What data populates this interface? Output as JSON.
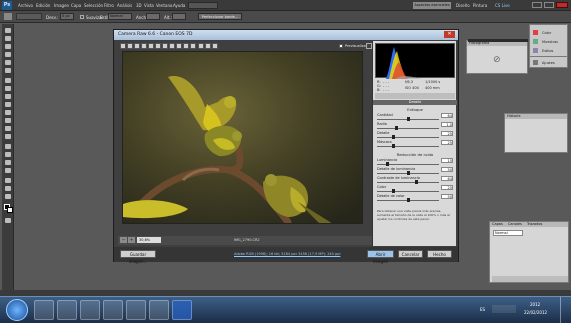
{
  "menubar": {
    "app_icon": "Ps",
    "items": [
      "Archivo",
      "Edición",
      "Imagen",
      "Capa",
      "Selección",
      "Filtro",
      "Análisis",
      "3D",
      "Vista",
      "Ventana",
      "Ayuda"
    ],
    "workspace_button": "Aspectos esenciales",
    "diseno": "Diseño",
    "pintura": "Pintura",
    "cs_live": "CS Live"
  },
  "optbar": {
    "desvanecer_label": "Desv.:",
    "desvanecer_value": "0 px",
    "suavizar_label": "Suavizar",
    "estilo_label": "Estilo:",
    "estilo_value": "Normal",
    "anch_label": "Anch.:",
    "alt_label": "Alt.:",
    "refine_button": "Perfeccionar borde..."
  },
  "dialog": {
    "title": "Camera Raw 6.6  -  Canon EOS 7D",
    "preview_label": "Previsualizar",
    "zoom_value": "30,6%",
    "filename": "IMG_2790.CR2",
    "workflow_link": "Adobe RGB (1998); 16 bit; 5184 por 3456 (17,9 MP); 240 ppi",
    "save_button": "Guardar imagen...",
    "open_button": "Abrir imagen",
    "cancel_button": "Cancelar",
    "done_button": "Hecho",
    "readout": {
      "f_value": "f/6,3",
      "shutter": "1/1000 s",
      "iso": "ISO 400",
      "lens": "400 mm",
      "r": "R:",
      "g": "G:",
      "b": "B:",
      "r_val": "- - -",
      "g_val": "- - -",
      "b_val": "- - -"
    },
    "panel_title": "Detalle",
    "sharpen_header": "Enfoque",
    "sharpen": [
      {
        "label": "Cantidad",
        "value": "64"
      },
      {
        "label": "Radio",
        "value": "1,0"
      },
      {
        "label": "Detalle",
        "value": "25"
      },
      {
        "label": "Máscara",
        "value": "25"
      }
    ],
    "nr_header": "Reducción de ruido",
    "nr": [
      {
        "label": "Luminancia",
        "value": "15"
      },
      {
        "label": "Detalle de luminancia",
        "value": "50"
      },
      {
        "label": "Contraste de luminancia",
        "value": "64"
      },
      {
        "label": "Color",
        "value": "25"
      },
      {
        "label": "Detalle de color",
        "value": "50"
      }
    ],
    "note": "Para obtener una vista previa más precisa, aumente el tamaño de la vista al 100% o más al ajustar los controles de este panel."
  },
  "panels": {
    "histogram_tab": "Histograma",
    "color_items": [
      "Color",
      "Muestras",
      "Estilos",
      "Ajustes"
    ],
    "history_tab": "Historia",
    "layers_tabs": [
      "Capas",
      "Canales",
      "Trazados"
    ],
    "blend_mode": "Normal"
  },
  "taskbar": {
    "time": "2012",
    "date": "22/02/2012",
    "lang": "ES"
  },
  "colors": {
    "accent": "#1d5a8e",
    "chrome": "#3a3a3a",
    "dialog_bg": "#3f3f3f"
  }
}
